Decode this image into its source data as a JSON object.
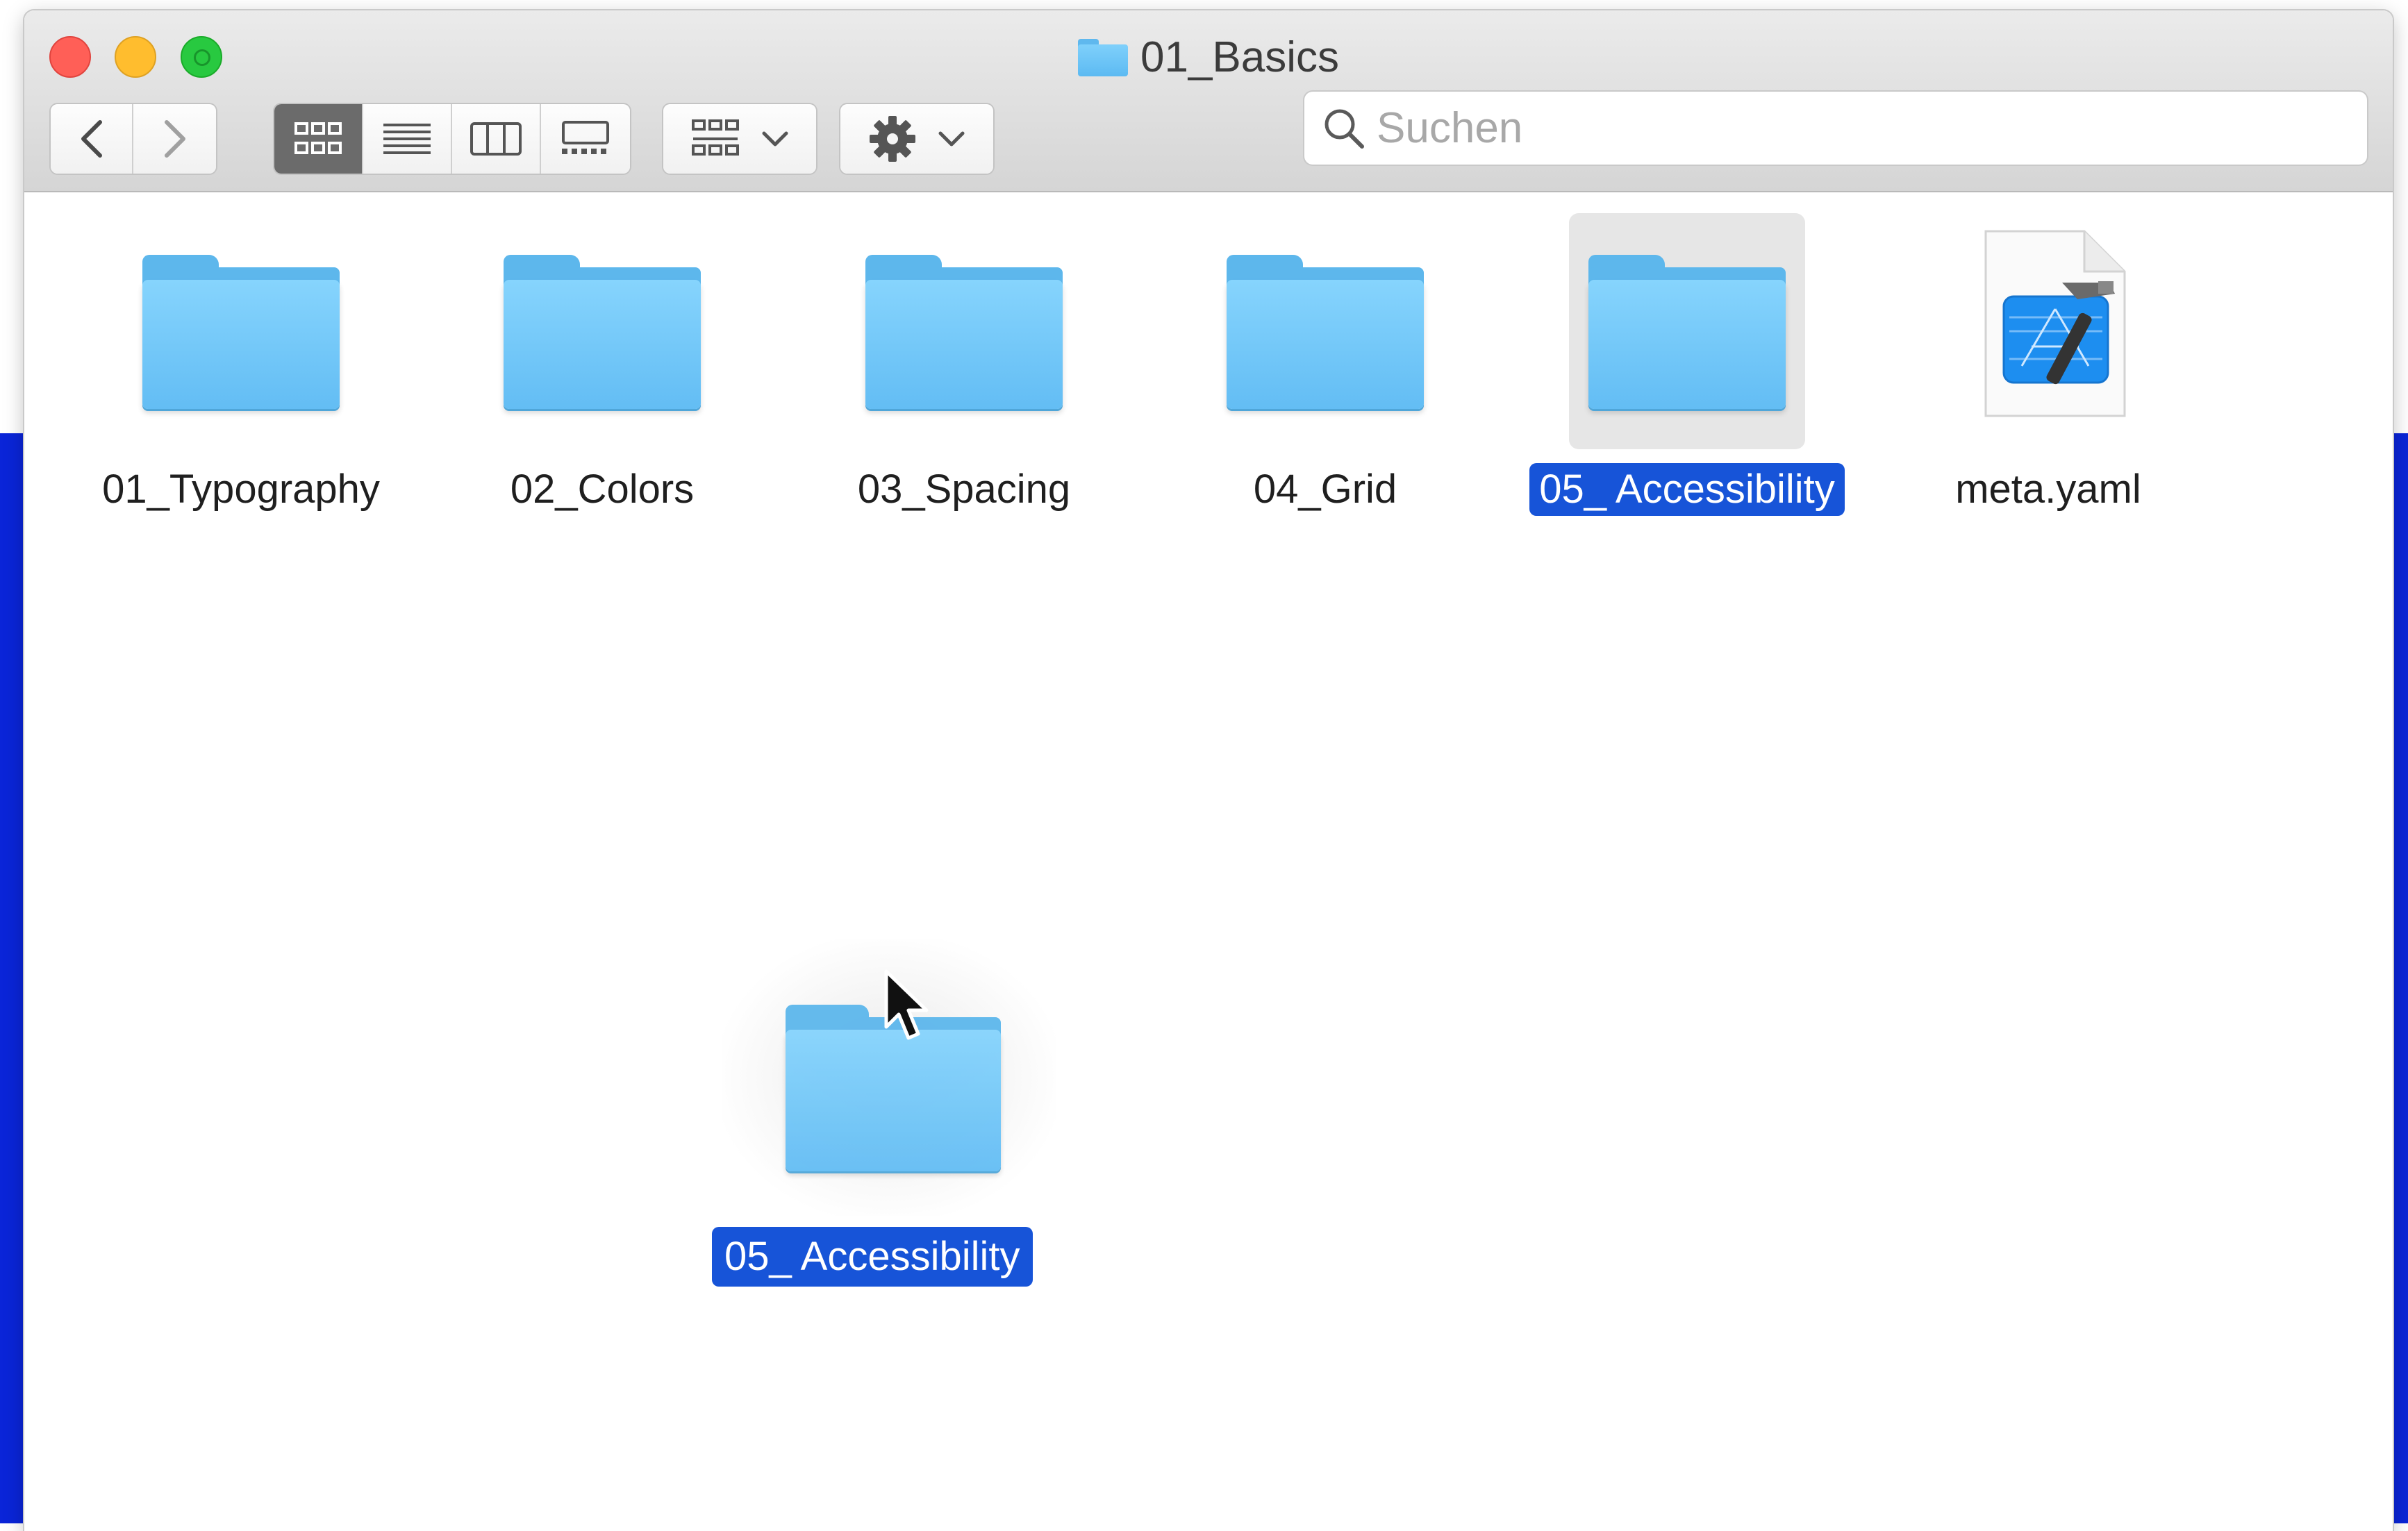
{
  "window": {
    "title": "01_Basics"
  },
  "toolbar": {
    "back_icon": "chevron-left-icon",
    "forward_icon": "chevron-right-icon",
    "views": [
      {
        "name": "icon-view",
        "active": true
      },
      {
        "name": "list-view",
        "active": false
      },
      {
        "name": "column-view",
        "active": false
      },
      {
        "name": "gallery-view",
        "active": false
      }
    ],
    "arrange_icon": "group-grid-icon",
    "action_icon": "gear-icon"
  },
  "search": {
    "placeholder": "Suchen",
    "value": ""
  },
  "items": [
    {
      "label": "01_Typography",
      "kind": "folder",
      "selected": false
    },
    {
      "label": "02_Colors",
      "kind": "folder",
      "selected": false
    },
    {
      "label": "03_Spacing",
      "kind": "folder",
      "selected": false
    },
    {
      "label": "04_Grid",
      "kind": "folder",
      "selected": false
    },
    {
      "label": "05_ Accessibility",
      "kind": "folder",
      "selected": true
    },
    {
      "label": "meta.yaml",
      "kind": "xcode-document",
      "selected": false
    }
  ],
  "drag": {
    "label": "05_ Accessibility",
    "icon": "folder-icon"
  },
  "colors": {
    "selection": "#1754d8",
    "folder": "#6cc4f7",
    "desktop": "#0a25d8",
    "close": "#ff5f57",
    "minimize": "#ffbd2e",
    "zoom": "#28c940"
  }
}
